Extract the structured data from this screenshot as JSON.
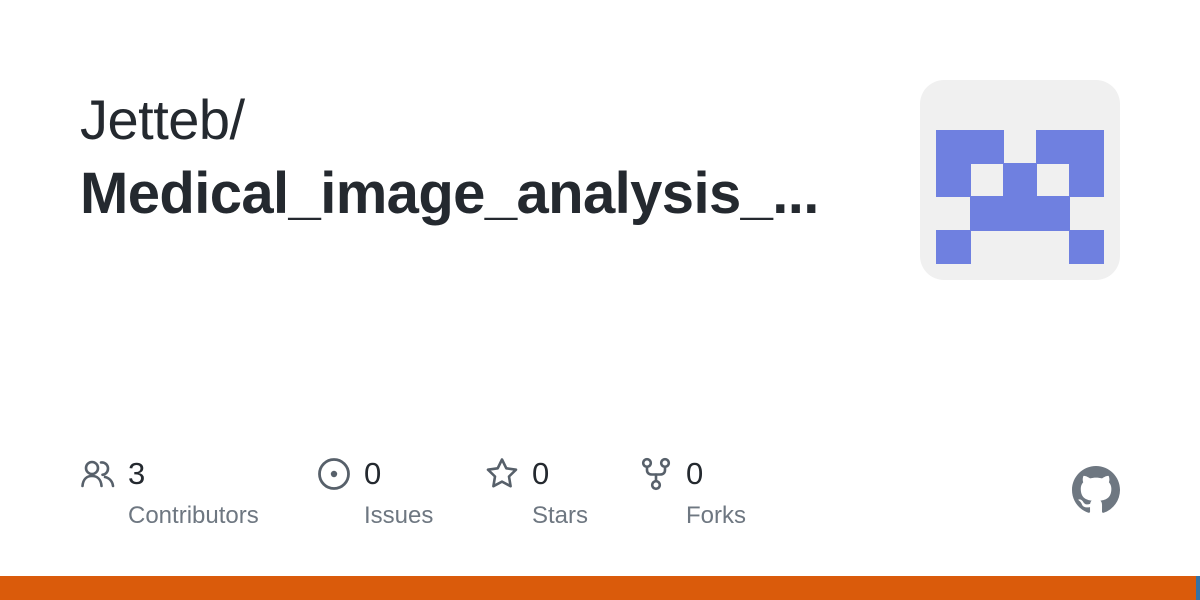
{
  "repo": {
    "owner": "Jetteb/",
    "name": "Medical_image_analysis_..."
  },
  "stats": [
    {
      "icon": "people-icon",
      "value": "3",
      "label": "Contributors"
    },
    {
      "icon": "issue-opened-icon",
      "value": "0",
      "label": "Issues"
    },
    {
      "icon": "star-icon",
      "value": "0",
      "label": "Stars"
    },
    {
      "icon": "repo-forked-icon",
      "value": "0",
      "label": "Forks"
    }
  ],
  "avatar": {
    "icon": "identicon",
    "color": "#6f80e0",
    "background": "#f0f0f0"
  },
  "brand_icon": "github-mark-icon",
  "colors": {
    "text": "#24292f",
    "muted": "#6e7781",
    "icon": "#57606a"
  },
  "language_bar": [
    {
      "color": "#DA5B0B",
      "fraction": 0.997
    },
    {
      "color": "#3572A5",
      "fraction": 0.003
    }
  ]
}
